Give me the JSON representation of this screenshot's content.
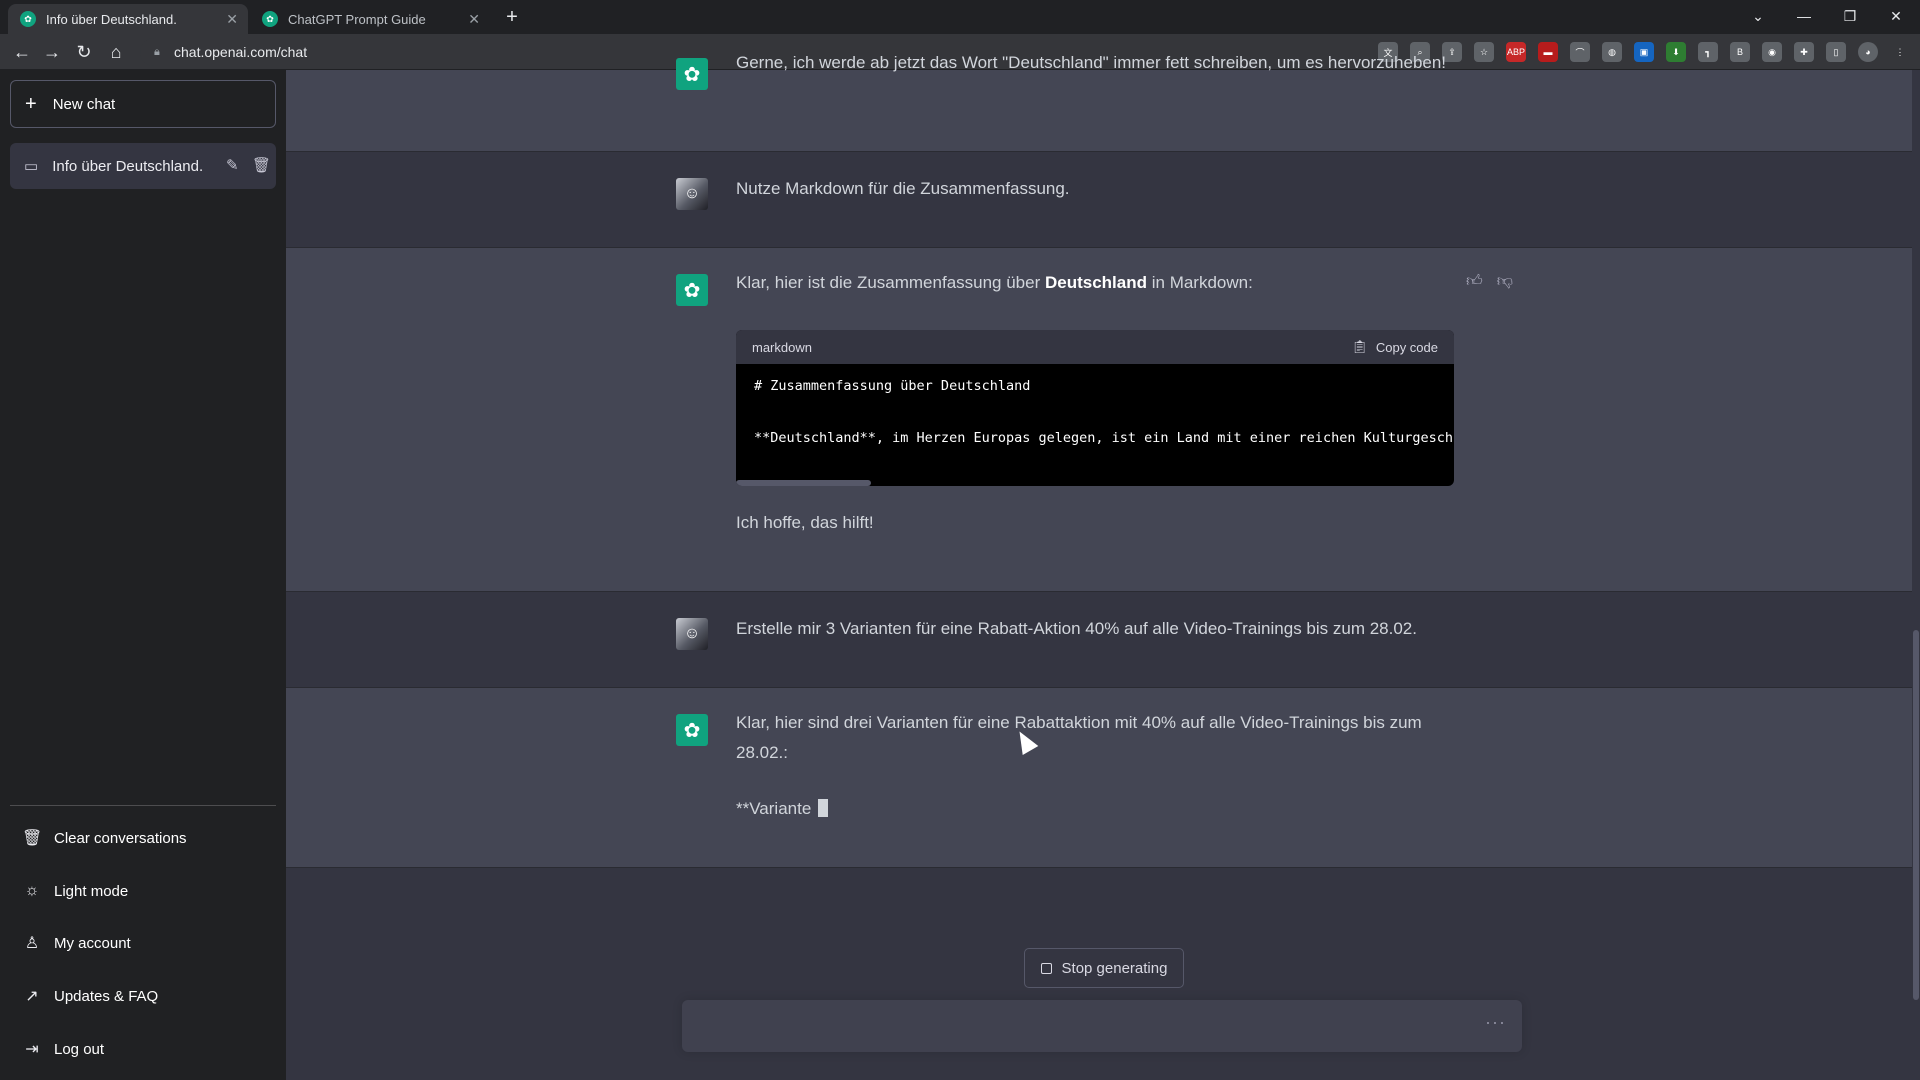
{
  "browser": {
    "tabs": [
      {
        "title": "Info über Deutschland.",
        "active": true
      },
      {
        "title": "ChatGPT Prompt Guide",
        "active": false
      }
    ],
    "url": "chat.openai.com/chat"
  },
  "sidebar": {
    "new_chat_label": "New chat",
    "conversation_title": "Info über Deutschland.",
    "links": [
      {
        "label": "Clear conversations",
        "icon": "trash-icon"
      },
      {
        "label": "Light mode",
        "icon": "sun-icon"
      },
      {
        "label": "My account",
        "icon": "user-icon"
      },
      {
        "label": "Updates & FAQ",
        "icon": "external-link-icon"
      },
      {
        "label": "Log out",
        "icon": "logout-icon"
      }
    ]
  },
  "messages": [
    {
      "role": "assistant",
      "text": "Gerne, ich werde ab jetzt das Wort \"Deutschland\" immer fett schreiben, um es hervorzuheben!"
    },
    {
      "role": "user",
      "text": "Nutze Markdown für die Zusammenfassung."
    },
    {
      "role": "assistant",
      "intro_before": "Klar, hier ist die Zusammenfassung über ",
      "intro_bold": "Deutschland",
      "intro_after": " in Markdown:",
      "code": {
        "language": "markdown",
        "copy_label": "Copy code",
        "line1": "# Zusammenfassung über Deutschland",
        "line2": "**Deutschland**, im Herzen Europas gelegen, ist ein Land mit einer reichen Kulturgeschichte"
      },
      "outro": "Ich hoffe, das hilft!"
    },
    {
      "role": "user",
      "text": "Erstelle mir 3 Varianten für eine Rabatt-Aktion 40% auf alle Video-Trainings bis zum 28.02."
    },
    {
      "role": "assistant",
      "text": "Klar, hier sind drei Varianten für eine Rabattaktion mit 40% auf alle Video-Trainings bis zum 28.02.:",
      "partial": "**Variante "
    }
  ],
  "stop_label": "Stop generating",
  "composer": {
    "placeholder": ""
  },
  "colors": {
    "accent": "#10a37f",
    "sidebar": "#202123",
    "main": "#343541",
    "ai_row": "#444654"
  }
}
